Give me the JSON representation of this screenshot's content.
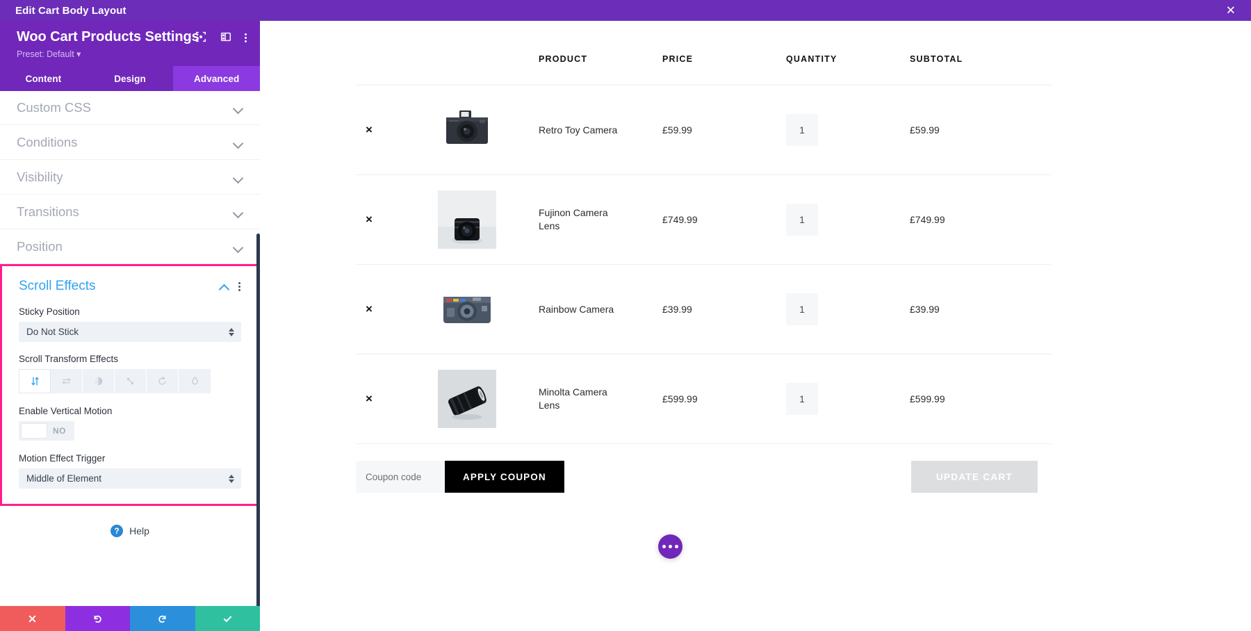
{
  "topbar": {
    "title": "Edit Cart Body Layout",
    "close_icon": "close-icon"
  },
  "panel": {
    "module_title": "Woo Cart Products Settings",
    "preset": "Preset: Default",
    "head_icons": [
      "target-icon",
      "layout-columns-icon",
      "kebab-menu-icon"
    ],
    "tabs": [
      {
        "label": "Content",
        "active": false
      },
      {
        "label": "Design",
        "active": false
      },
      {
        "label": "Advanced",
        "active": true
      }
    ],
    "accordions": [
      {
        "label": "Custom CSS"
      },
      {
        "label": "Conditions"
      },
      {
        "label": "Visibility"
      },
      {
        "label": "Transitions"
      },
      {
        "label": "Position"
      }
    ],
    "scroll_effects": {
      "title": "Scroll Effects",
      "highlight_color": "#ff1e8e",
      "title_color": "#2ea3f2",
      "sticky_position_label": "Sticky Position",
      "sticky_position_value": "Do Not Stick",
      "transform_label": "Scroll Transform Effects",
      "transform_effects": [
        {
          "name": "vertical-motion-icon",
          "active": true
        },
        {
          "name": "horizontal-motion-icon",
          "active": false
        },
        {
          "name": "fade-icon",
          "active": false
        },
        {
          "name": "scale-icon",
          "active": false
        },
        {
          "name": "rotate-icon",
          "active": false
        },
        {
          "name": "blur-icon",
          "active": false
        }
      ],
      "vertical_motion_label": "Enable Vertical Motion",
      "vertical_motion_value": "NO",
      "trigger_label": "Motion Effect Trigger",
      "trigger_value": "Middle of Element"
    },
    "help_label": "Help",
    "actions": [
      {
        "name": "cancel-button",
        "icon": "✖",
        "color": "#f05c5c"
      },
      {
        "name": "undo-button",
        "icon": "↺",
        "color": "#8d2fe0"
      },
      {
        "name": "redo-button",
        "icon": "↻",
        "color": "#2b8fdc"
      },
      {
        "name": "save-button",
        "icon": "✔",
        "color": "#2fc0a0"
      }
    ]
  },
  "cart": {
    "columns": [
      "",
      "",
      "PRODUCT",
      "PRICE",
      "QUANTITY",
      "SUBTOTAL"
    ],
    "rows": [
      {
        "remove": "×",
        "thumb": "retro-toy-camera-thumbnail",
        "name": "Retro Toy Camera",
        "price": "£59.99",
        "quantity": "1",
        "subtotal": "£59.99"
      },
      {
        "remove": "×",
        "thumb": "fujinon-camera-lens-thumbnail",
        "name": "Fujinon Camera Lens",
        "price": "£749.99",
        "quantity": "1",
        "subtotal": "£749.99"
      },
      {
        "remove": "×",
        "thumb": "rainbow-camera-thumbnail",
        "name": "Rainbow Camera",
        "price": "£39.99",
        "quantity": "1",
        "subtotal": "£39.99"
      },
      {
        "remove": "×",
        "thumb": "minolta-camera-lens-thumbnail",
        "name": "Minolta Camera Lens",
        "price": "£599.99",
        "quantity": "1",
        "subtotal": "£599.99"
      }
    ],
    "coupon_placeholder": "Coupon code",
    "coupon_value": "",
    "apply_coupon_label": "APPLY COUPON",
    "update_cart_label": "UPDATE CART",
    "fab": "more-options-button"
  }
}
